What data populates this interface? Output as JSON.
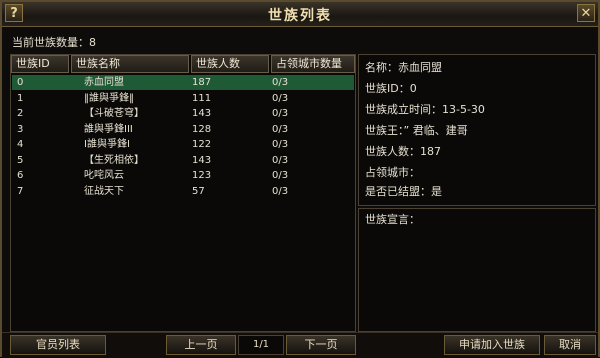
{
  "window": {
    "title": "世族列表",
    "help_glyph": "?",
    "close_glyph": "✕"
  },
  "count_label": "当前世族数量：8",
  "columns": [
    "世族ID",
    "世族名称",
    "世族人数",
    "占领城市数量"
  ],
  "rows": [
    {
      "id": "0",
      "name": "赤血同盟",
      "members": "187",
      "cities": "0/3"
    },
    {
      "id": "1",
      "name": "‖誰與爭鋒‖",
      "members": "111",
      "cities": "0/3"
    },
    {
      "id": "2",
      "name": "【斗破苍穹】",
      "members": "143",
      "cities": "0/3"
    },
    {
      "id": "3",
      "name": "誰與爭鋒III",
      "members": "128",
      "cities": "0/3"
    },
    {
      "id": "4",
      "name": "Ⅰ誰與爭鋒Ⅰ",
      "members": "122",
      "cities": "0/3"
    },
    {
      "id": "5",
      "name": "【生死相依】",
      "members": "143",
      "cities": "0/3"
    },
    {
      "id": "6",
      "name": "叱咤风云",
      "members": "123",
      "cities": "0/3"
    },
    {
      "id": "7",
      "name": "征战天下",
      "members": "57",
      "cities": "0/3"
    }
  ],
  "info": {
    "name": "名称：赤血同盟",
    "id": "世族ID：0",
    "founded": "世族成立时间：13-5-30",
    "king": "世族王：” 君临、建哥",
    "members": "世族人数：187",
    "cities": "占领城市：",
    "allied": "是否已结盟：是"
  },
  "declaration_label": "世族宣言：",
  "buttons": {
    "officials": "官员列表",
    "prev": "上一页",
    "page": "1/1",
    "next": "下一页",
    "apply": "申请加入世族",
    "cancel": "取消"
  },
  "colors": {
    "selected_row": "#1e5a36",
    "title_text": "#f0dfb0",
    "frame": "#5a4a2e"
  }
}
